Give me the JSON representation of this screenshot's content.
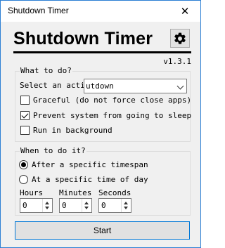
{
  "window": {
    "title": "Shutdown Timer",
    "close_glyph": "✕"
  },
  "header": {
    "title": "Shutdown Timer",
    "settings_icon": "gear-icon",
    "version": "v1.3.1"
  },
  "what_to_do": {
    "group_label": "What to do?",
    "action_label": "Select an action",
    "action_value": "utdown",
    "options": [
      {
        "label": "Graceful (do not force close apps)",
        "checked": false
      },
      {
        "label": "Prevent system from going to sleep",
        "checked": true
      },
      {
        "label": "Run in background",
        "checked": false
      }
    ]
  },
  "when_to_do": {
    "group_label": "When to do it?",
    "modes": [
      {
        "label": "After a specific timespan",
        "selected": true
      },
      {
        "label": "At a specific time of day",
        "selected": false
      }
    ],
    "fields": [
      {
        "label": "Hours",
        "value": "0"
      },
      {
        "label": "Minutes",
        "value": "0"
      },
      {
        "label": "Seconds",
        "value": "0"
      }
    ]
  },
  "start_label": "Start"
}
